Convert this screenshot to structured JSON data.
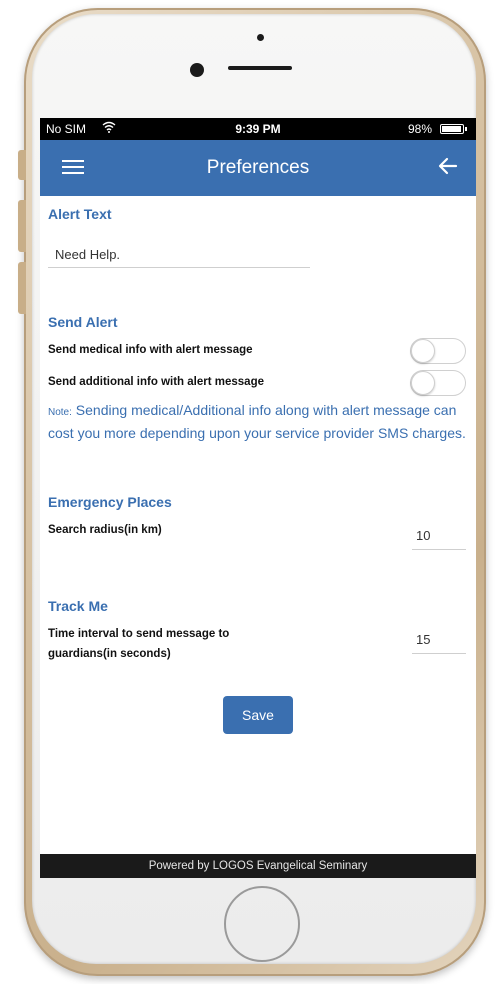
{
  "status_bar": {
    "carrier": "No SIM",
    "time": "9:39 PM",
    "battery": "98%"
  },
  "header": {
    "title": "Preferences",
    "background_color": "#3a6fb0"
  },
  "alert_text": {
    "section_title": "Alert Text",
    "value": "Need Help."
  },
  "send_alert": {
    "section_title": "Send Alert",
    "medical_info_label": "Send medical info with alert message",
    "medical_info_enabled": false,
    "additional_info_label": "Send additional info with alert message",
    "additional_info_enabled": false,
    "note_prefix": "Note:",
    "note_text": " Sending medical/Additional info along with alert message can cost you more depending upon your service provider SMS charges."
  },
  "emergency_places": {
    "section_title": "Emergency Places",
    "radius_label": "Search radius(in km)",
    "radius_value": "10"
  },
  "track_me": {
    "section_title": "Track Me",
    "interval_label_line1": "Time interval to send message to",
    "interval_label_line2": "guardians(in seconds)",
    "interval_value": "15"
  },
  "actions": {
    "save_label": "Save"
  },
  "footer": {
    "text": "Powered by LOGOS Evangelical Seminary"
  }
}
